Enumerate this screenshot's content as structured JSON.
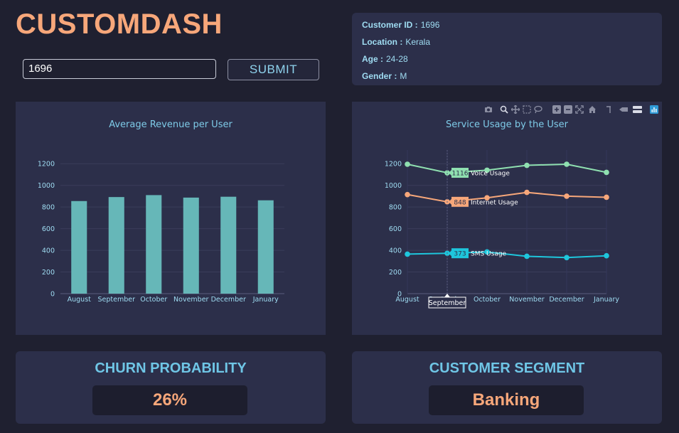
{
  "app": {
    "title": "CUSTOMDASH"
  },
  "search": {
    "value": "1696",
    "submit_label": "SUBMIT"
  },
  "customer": {
    "id_label": "Customer ID :",
    "id": "1696",
    "location_label": "Location :",
    "location": "Kerala",
    "age_label": "Age :",
    "age": "24-28",
    "gender_label": "Gender :",
    "gender": "M"
  },
  "churn": {
    "title": "CHURN PROBABILITY",
    "value": "26%"
  },
  "segment": {
    "title": "CUSTOMER SEGMENT",
    "value": "Banking"
  },
  "modebar": {
    "icons": [
      "camera-icon",
      "zoom-icon",
      "pan-icon",
      "box-select-icon",
      "lasso-icon",
      "zoom-in-icon",
      "zoom-out-icon",
      "autoscale-icon",
      "reset-axes-icon",
      "spike-lines-icon",
      "hover-closest-icon",
      "hover-compare-icon",
      "plotly-logo-icon"
    ]
  },
  "chart_data": [
    {
      "type": "bar",
      "title": "Average Revenue per User",
      "categories": [
        "August",
        "September",
        "October",
        "November",
        "December",
        "January"
      ],
      "values": [
        855,
        892,
        910,
        887,
        895,
        862
      ],
      "ylim": [
        0,
        1300
      ],
      "yticks": [
        0,
        200,
        400,
        600,
        800,
        1000,
        1200
      ],
      "color": "#66b7b8",
      "grid": true
    },
    {
      "type": "line",
      "title": "Service Usage by the User",
      "categories": [
        "August",
        "September",
        "October",
        "November",
        "December",
        "January"
      ],
      "ylim": [
        0,
        1300
      ],
      "yticks": [
        0,
        200,
        400,
        600,
        800,
        1000,
        1200
      ],
      "grid": true,
      "series": [
        {
          "name": "Voice Usage",
          "values": [
            1195,
            1116,
            1140,
            1185,
            1195,
            1120
          ],
          "color": "#8fe0b0"
        },
        {
          "name": "Internet Usage",
          "values": [
            915,
            848,
            885,
            935,
            900,
            890
          ],
          "color": "#f7a77a"
        },
        {
          "name": "SMS Usage",
          "values": [
            365,
            373,
            385,
            345,
            333,
            350
          ],
          "color": "#1ec6dc"
        }
      ],
      "hover": {
        "category": "September",
        "labels": [
          "1116",
          "848",
          "373"
        ]
      }
    }
  ]
}
